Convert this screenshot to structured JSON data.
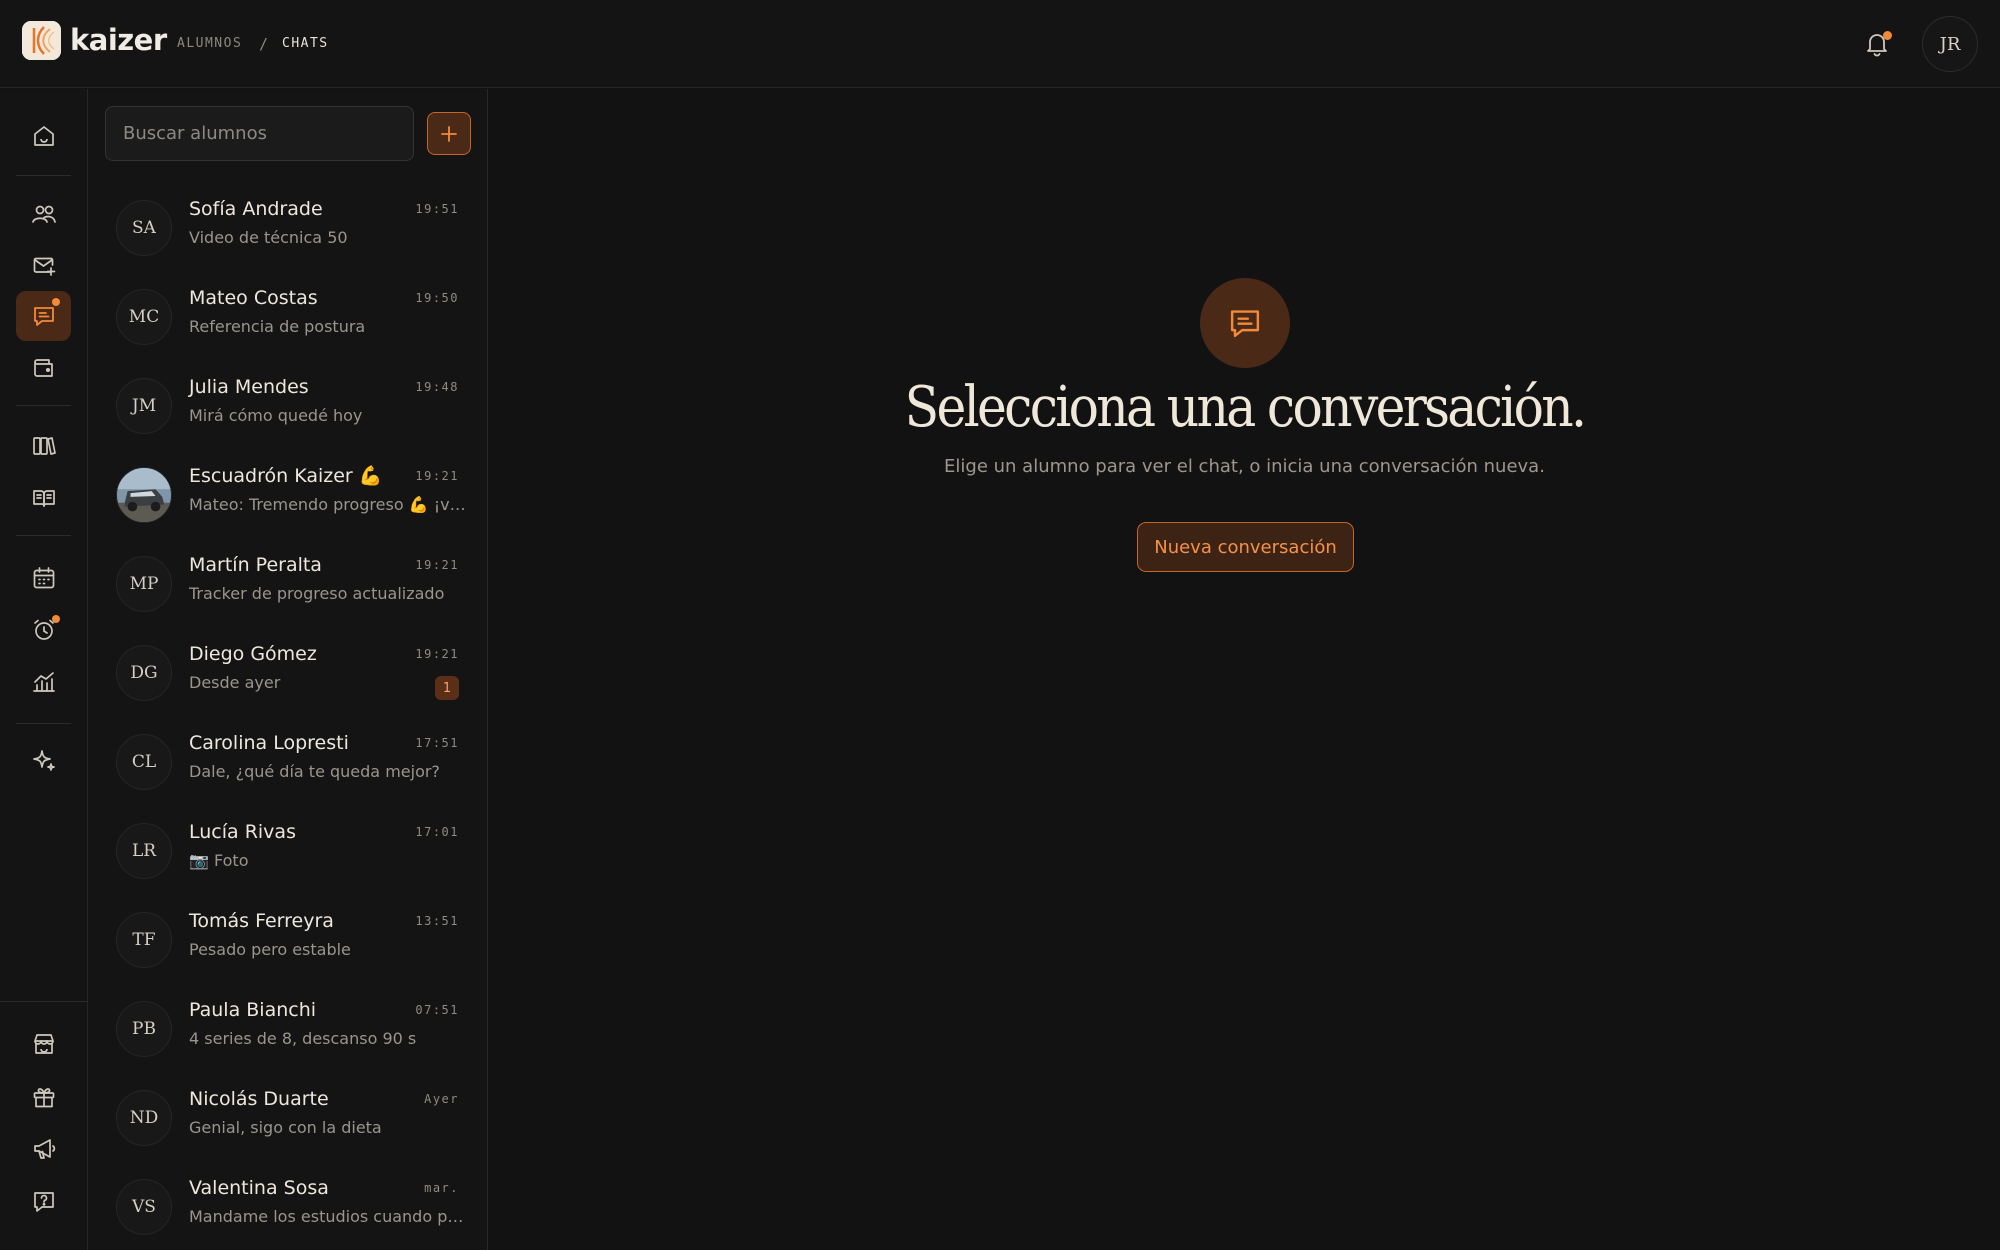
{
  "header": {
    "brand": "kaizer",
    "breadcrumb": [
      "ALUMNOS",
      "/",
      "CHATS"
    ],
    "user_initials": "JR"
  },
  "nav": {
    "items": [
      "home-icon",
      "users-icon",
      "mail-plus-icon",
      "chat-icon",
      "wallet-icon",
      "books-icon",
      "open-book-icon",
      "calendar-icon",
      "alarm-icon",
      "chart-icon",
      "sparkle-icon",
      "store-icon",
      "gift-icon",
      "megaphone-icon",
      "help-icon"
    ],
    "active": "chat-icon"
  },
  "list": {
    "search_placeholder": "Buscar alumnos",
    "chats": [
      {
        "initials": "SA",
        "name": "Sofía Andrade",
        "preview": "Video de técnica 50",
        "time": "19:51"
      },
      {
        "initials": "MC",
        "name": "Mateo Costas",
        "preview": "Referencia de postura",
        "time": "19:50"
      },
      {
        "initials": "JM",
        "name": "Julia Mendes",
        "preview": "Mirá cómo quedé hoy",
        "time": "19:48"
      },
      {
        "initials": "",
        "name": "Escuadrón Kaizer 💪",
        "preview": "Mateo: Tremendo progreso 💪 ¡vamos equipo!",
        "time": "19:21"
      },
      {
        "initials": "MP",
        "name": "Martín Peralta",
        "preview": "Tracker de progreso actualizado",
        "time": "19:21"
      },
      {
        "initials": "DG",
        "name": "Diego Gómez",
        "preview": "Desde ayer",
        "time": "19:21",
        "unread": "1"
      },
      {
        "initials": "CL",
        "name": "Carolina Lopresti",
        "preview": "Dale, ¿qué día te queda mejor?",
        "time": "17:51"
      },
      {
        "initials": "LR",
        "name": "Lucía Rivas",
        "preview": "📷 Foto",
        "time": "17:01"
      },
      {
        "initials": "TF",
        "name": "Tomás Ferreyra",
        "preview": "Pesado pero estable",
        "time": "13:51"
      },
      {
        "initials": "PB",
        "name": "Paula Bianchi",
        "preview": "4 series de 8, descanso 90 s",
        "time": "07:51"
      },
      {
        "initials": "ND",
        "name": "Nicolás Duarte",
        "preview": "Genial, sigo con la dieta",
        "time": "Ayer"
      },
      {
        "initials": "VS",
        "name": "Valentina Sosa",
        "preview": "Mandame los estudios cuando puedas",
        "time": "mar."
      }
    ]
  },
  "main": {
    "title": "Selecciona una conversación.",
    "subtitle": "Elige un alumno para ver el chat, o inicia una conversación nueva.",
    "button_label": "Nueva conversación"
  },
  "colors": {
    "accent": "#f28a3a",
    "accent_bg": "#4a2a17",
    "background": "#121212"
  }
}
